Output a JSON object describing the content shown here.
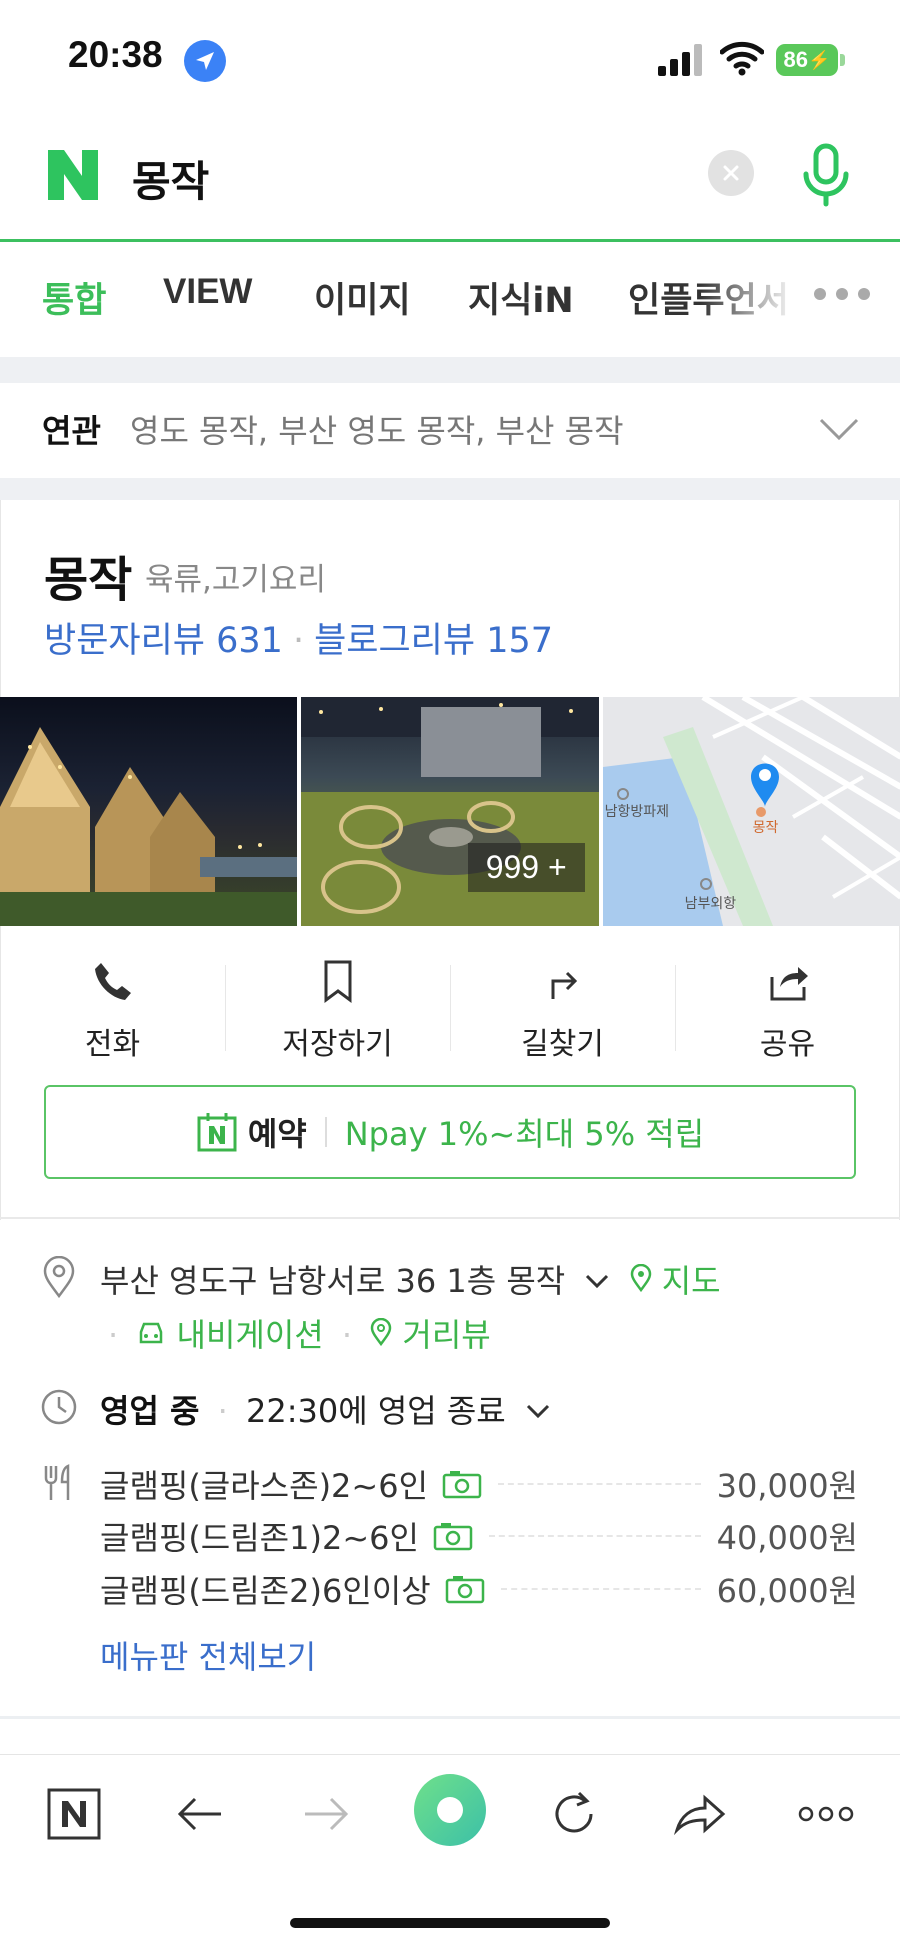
{
  "status_bar": {
    "time": "20:38",
    "battery": "86"
  },
  "search": {
    "query": "몽작"
  },
  "tabs": [
    {
      "label": "통합"
    },
    {
      "label": "VIEW"
    },
    {
      "label": "이미지"
    },
    {
      "label": "지식iN"
    },
    {
      "label": "인플루언서"
    }
  ],
  "related": {
    "label": "연관",
    "text": "영도 몽작, 부산 영도 몽작, 부산 몽작"
  },
  "place": {
    "name": "몽작",
    "category": "육류,고기요리",
    "visitor_reviews": "방문자리뷰 631",
    "blog_reviews": "블로그리뷰 157",
    "photo_count": "999 +",
    "map_place_label": "몽작",
    "map_label_1": "남항방파제",
    "map_label_2": "남부외항"
  },
  "actions": {
    "call": "전화",
    "save": "저장하기",
    "directions": "길찾기",
    "share": "공유"
  },
  "booking": {
    "label": "예약",
    "npay": "Npay 1%~최대 5% 적립"
  },
  "info": {
    "address": "부산 영도구 남항서로 36 1층 몽작",
    "map_link": "지도",
    "navigation": "내비게이션",
    "street_view": "거리뷰",
    "status": "영업 중",
    "hours": "22:30에 영업 종료"
  },
  "menu": [
    {
      "name": "글램핑(글라스존)2~6인",
      "price": "30,000원"
    },
    {
      "name": "글램핑(드림존1)2~6인",
      "price": "40,000원"
    },
    {
      "name": "글램핑(드림존2)6인이상",
      "price": "60,000원"
    }
  ],
  "menu_all": "메뉴판 전체보기",
  "colors": {
    "brand": "#03c75a",
    "accent_green": "#3cb44b",
    "link_blue": "#3a6ecb"
  }
}
